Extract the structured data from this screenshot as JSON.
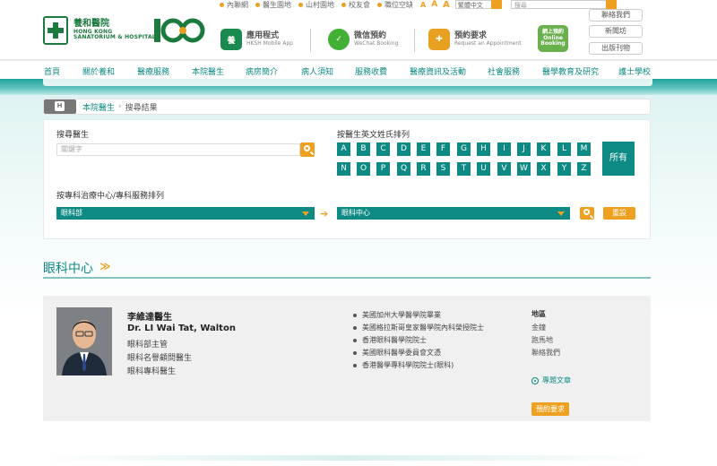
{
  "header": {
    "logo": {
      "cn": "養和醫院",
      "en1": "HONG KONG",
      "en2": "SANATORIUM & HOSPITAL"
    },
    "anniversary": "100",
    "apps": [
      {
        "title": "應用程式",
        "sub": "HKSH Mobile App",
        "icon_label": "養",
        "icon_color": "#1b8a4e"
      },
      {
        "title": "微信預約",
        "sub": "WeChat Booking",
        "icon_label": "✓",
        "icon_color": "#41b035"
      },
      {
        "title": "預約要求",
        "sub": "Request an Appointment",
        "icon_label": "✚",
        "icon_color": "#e8a020"
      },
      {
        "title": "網上預約 Online Booking",
        "sub": "",
        "icon_label": "網",
        "icon_color": "#6ab04c"
      }
    ],
    "toplinks": [
      "內聯網",
      "醫生園地",
      "山村園地",
      "校友會",
      "職位空缺"
    ],
    "font_sizes": [
      "A",
      "A",
      "A"
    ],
    "language": "繁體中文",
    "search_placeholder": "搜尋",
    "side_buttons": [
      "聯絡我們",
      "新聞坊",
      "出版刊物"
    ]
  },
  "nav": [
    "首頁",
    "關於養和",
    "醫療服務",
    "本院醫生",
    "病房簡介",
    "病人須知",
    "服務收費",
    "醫療資訊及活動",
    "社會服務",
    "醫學教育及研究",
    "護士學校"
  ],
  "breadcrumb": {
    "link": "本院醫生",
    "current": "搜尋結果"
  },
  "search": {
    "keyword_label": "搜尋醫生",
    "keyword_placeholder": "關鍵字",
    "alpha_label": "按醫生英文姓氏排列",
    "letters_row1": [
      "A",
      "B",
      "C",
      "D",
      "E",
      "F",
      "G",
      "H",
      "I",
      "J",
      "K",
      "L",
      "M"
    ],
    "letters_row2": [
      "N",
      "O",
      "P",
      "Q",
      "R",
      "S",
      "T",
      "U",
      "V",
      "W",
      "X",
      "Y",
      "Z"
    ],
    "all_label": "所有",
    "specialty_label": "按專科治療中心/專科服務排列",
    "dept_value": "眼科部",
    "center_value": "眼科中心",
    "reset_label": "重設"
  },
  "section": {
    "title": "眼科中心"
  },
  "doctor": {
    "name_cn": "李維達醫生",
    "name_en": "Dr. LI Wai Tat, Walton",
    "titles": [
      "眼科部主管",
      "眼科名譽顧問醫生",
      "眼科專科醫生"
    ],
    "qualifications": [
      "美國加州大學醫學院畢業",
      "美國格拉斯哥皇家醫學院內科榮授院士",
      "香港眼科醫學院院士",
      "美國眼科醫學委員會文憑",
      "香港醫學專科學院院士(眼科)"
    ],
    "location_header": "地區",
    "locations": [
      "金鐘",
      "跑馬地",
      "聯絡我們"
    ],
    "article_label": "專題文章",
    "appointment_label": "預約要求"
  }
}
